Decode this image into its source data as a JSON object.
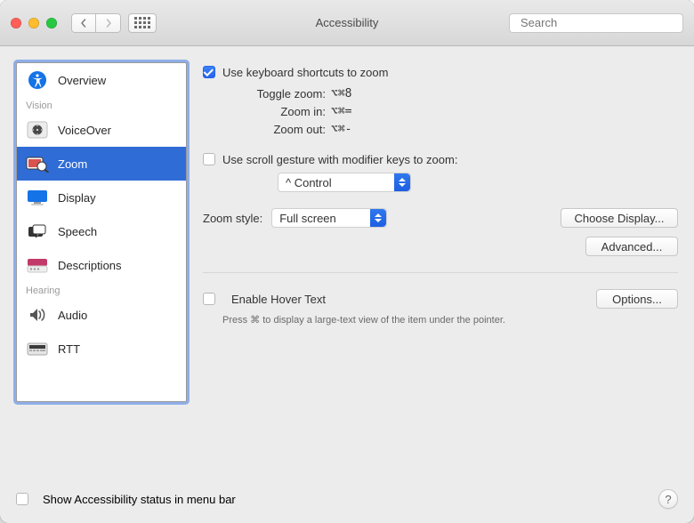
{
  "window": {
    "title": "Accessibility"
  },
  "search": {
    "placeholder": "Search"
  },
  "sidebar": {
    "overview": "Overview",
    "cat_vision": "Vision",
    "voiceover": "VoiceOver",
    "zoom": "Zoom",
    "display": "Display",
    "speech": "Speech",
    "descriptions": "Descriptions",
    "cat_hearing": "Hearing",
    "audio": "Audio",
    "rtt": "RTT"
  },
  "main": {
    "use_keyboard": "Use keyboard shortcuts to zoom",
    "kv": {
      "toggle_label": "Toggle zoom:",
      "toggle_val": "⌥⌘8",
      "in_label": "Zoom in:",
      "in_val": "⌥⌘=",
      "out_label": "Zoom out:",
      "out_val": "⌥⌘-"
    },
    "use_scroll": "Use scroll gesture with modifier keys to zoom:",
    "modifier_select": "^ Control",
    "zoom_style_label": "Zoom style:",
    "zoom_style_value": "Full screen",
    "choose_display": "Choose Display...",
    "advanced": "Advanced...",
    "hover_text": "Enable Hover Text",
    "options": "Options...",
    "hover_hint": "Press ⌘ to display a large-text view of the item under the pointer."
  },
  "footer": {
    "show_status": "Show Accessibility status in menu bar",
    "help": "?"
  }
}
